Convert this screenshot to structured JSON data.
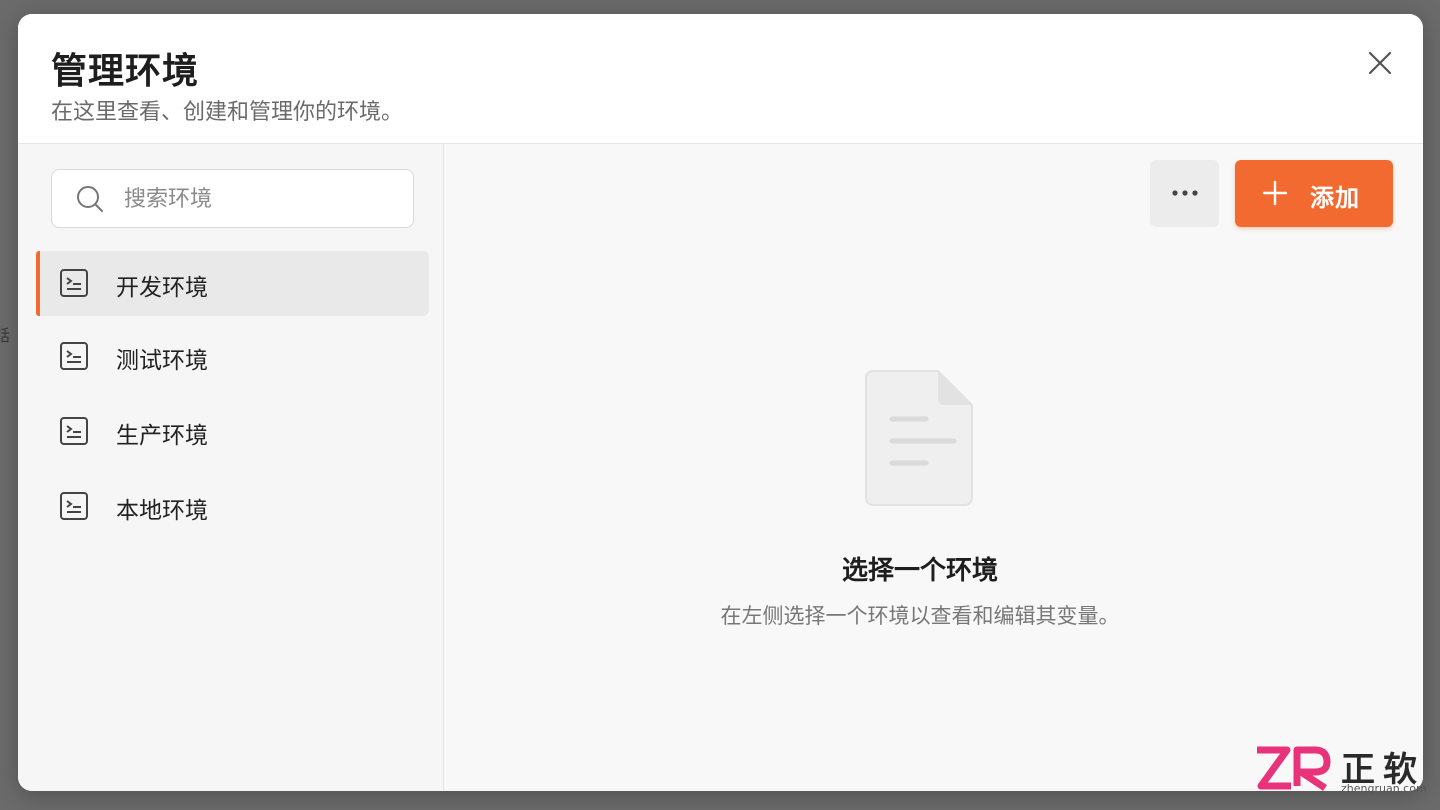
{
  "backdrop": {
    "fragment": "話"
  },
  "modal": {
    "title": "管理环境",
    "subtitle": "在这里查看、创建和管理你的环境。"
  },
  "sidebar": {
    "search": {
      "placeholder": "搜索环境",
      "value": ""
    },
    "items": [
      {
        "label": "开发环境",
        "active": true
      },
      {
        "label": "测试环境",
        "active": false
      },
      {
        "label": "生产环境",
        "active": false
      },
      {
        "label": "本地环境",
        "active": false
      }
    ]
  },
  "toolbar": {
    "more_icon": "ellipsis-icon",
    "add_label": "添加",
    "add_icon": "plus-icon"
  },
  "empty_state": {
    "icon": "document-icon",
    "title": "选择一个环境",
    "description": "在左侧选择一个环境以查看和编辑其变量。"
  },
  "watermark": {
    "brand": "正软",
    "url": "zhengruan.com"
  },
  "colors": {
    "accent": "#f26a30",
    "sidebar_bg": "#f6f6f6",
    "content_bg": "#f8f8f8",
    "active_item_bg": "#e9e9ea"
  }
}
